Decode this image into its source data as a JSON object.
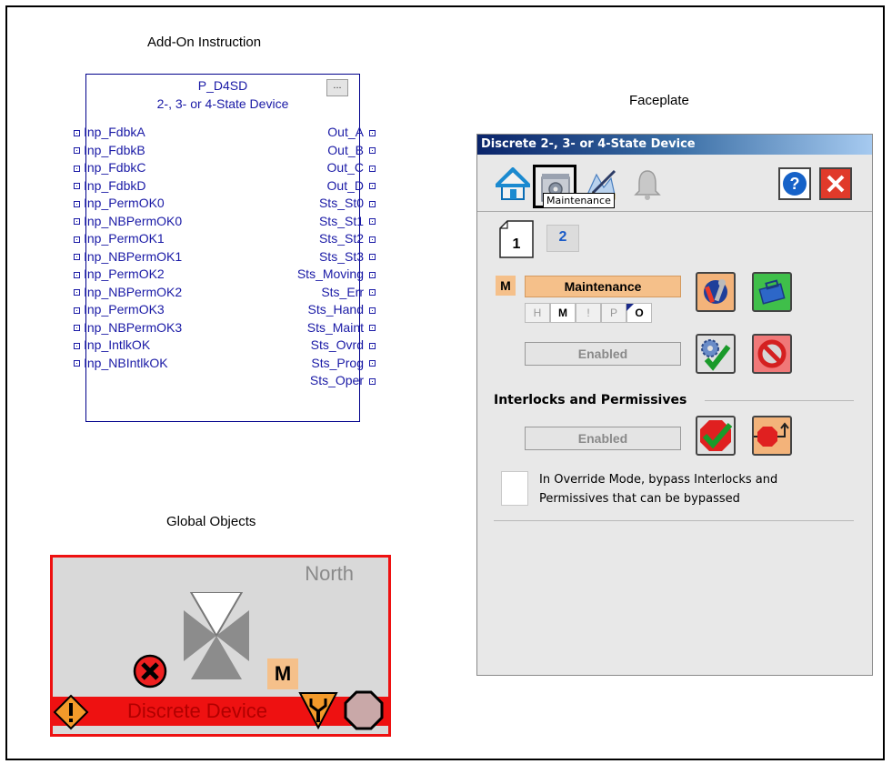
{
  "sections": {
    "aoi_title": "Add-On Instruction",
    "faceplate_title": "Faceplate",
    "global_title": "Global Objects"
  },
  "aoi": {
    "name": "P_D4SD",
    "description": "2-, 3- or 4-State Device",
    "button_label": "...",
    "inputs": [
      "Inp_FdbkA",
      "Inp_FdbkB",
      "Inp_FdbkC",
      "Inp_FdbkD",
      "Inp_PermOK0",
      "Inp_NBPermOK0",
      "Inp_PermOK1",
      "Inp_NBPermOK1",
      "Inp_PermOK2",
      "Inp_NBPermOK2",
      "Inp_PermOK3",
      "Inp_NBPermOK3",
      "Inp_IntlkOK",
      "Inp_NBIntlkOK"
    ],
    "outputs": [
      "Out_A",
      "Out_B",
      "Out_C",
      "Out_D",
      "Sts_St0",
      "Sts_St1",
      "Sts_St2",
      "Sts_St3",
      "Sts_Moving",
      "Sts_Err",
      "Sts_Hand",
      "Sts_Maint",
      "Sts_Ovrd",
      "Sts_Prog",
      "Sts_Oper"
    ]
  },
  "faceplate": {
    "title": "Discrete 2-, 3- or 4-State Device",
    "tooltip": "Maintenance",
    "page_tabs": [
      "1",
      "2"
    ],
    "mode_badge": "M",
    "mode_label": "Maintenance",
    "mode_cells": [
      "H",
      "M",
      "!",
      "P",
      "O"
    ],
    "maint_status": "Enabled",
    "interlocks_heading": "Interlocks and Permissives",
    "interlock_status": "Enabled",
    "override_text_1": "In Override Mode, bypass Interlocks and",
    "override_text_2": "Permissives that can be bypassed",
    "icons": [
      "home-icon",
      "maintenance-icon",
      "engineering-icon",
      "alarm-bell-icon",
      "help-icon",
      "close-icon"
    ]
  },
  "global_object": {
    "tag": "North",
    "label": "Discrete Device",
    "mode_badge": "M"
  },
  "colors": {
    "aoi_text": "#1a1aa6",
    "mode_badge": "#f5c08a",
    "alarm_red": "#ee1111",
    "close_red": "#e03a2a"
  }
}
